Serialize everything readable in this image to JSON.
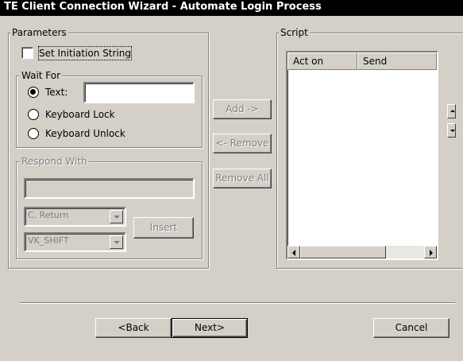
{
  "window": {
    "title": "TE Client Connection Wizard - Automate Login Process"
  },
  "parameters": {
    "legend": "Parameters",
    "set_initiation_string": {
      "label": "Set Initiation String",
      "checked": false
    }
  },
  "wait_for": {
    "legend": "Wait For",
    "options": [
      {
        "label": "Text:",
        "selected": true
      },
      {
        "label": "Keyboard Lock",
        "selected": false
      },
      {
        "label": "Keyboard Unlock",
        "selected": false
      }
    ],
    "text_value": ""
  },
  "respond_with": {
    "legend": "Respond With",
    "text_value": "",
    "key_combo": "C. Return",
    "modifier_combo": "VK_SHIFT",
    "insert_label": "Insert"
  },
  "middle_buttons": {
    "add": "Add ->",
    "remove": "<- Remove",
    "remove_all": "Remove All"
  },
  "script": {
    "legend": "Script",
    "columns": [
      "Act on",
      "Send"
    ]
  },
  "footer": {
    "back": "<Back",
    "next": "Next>",
    "cancel": "Cancel"
  }
}
